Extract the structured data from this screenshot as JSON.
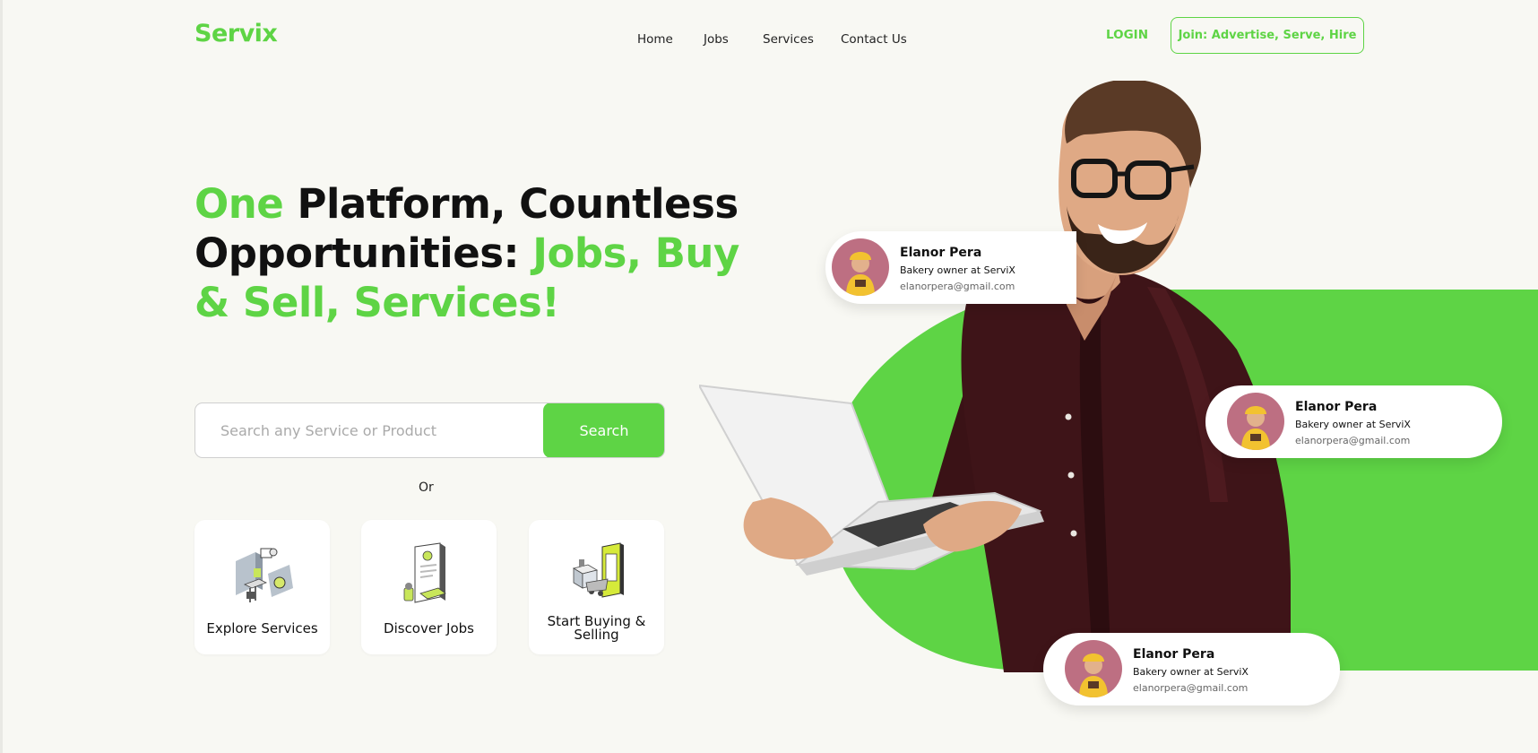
{
  "brand": {
    "logo": "Servix",
    "accent_color": "#5ed445"
  },
  "nav": {
    "items": [
      "Home",
      "Jobs",
      "Services",
      "Contact Us"
    ],
    "login_label": "LOGIN",
    "join_label": "Join: Advertise, Serve, Hire"
  },
  "hero": {
    "title_part1": "One",
    "title_part2": " Platform, Countless Opportunities: ",
    "title_part3": "Jobs, Buy & Sell, Services!"
  },
  "search": {
    "placeholder": "Search any Service or Product",
    "button_label": "Search",
    "or_label": "Or"
  },
  "cards": [
    {
      "label": "Explore Services",
      "icon": "services-illustration-icon"
    },
    {
      "label": "Discover Jobs",
      "icon": "jobs-illustration-icon"
    },
    {
      "label": "Start Buying & Selling",
      "icon": "buying-selling-illustration-icon"
    }
  ],
  "profiles": [
    {
      "name": "Elanor Pera",
      "role": "Bakery owner at ServiX",
      "email": "elanorpera@gmail.com"
    },
    {
      "name": "Elanor Pera",
      "role": "Bakery owner at ServiX",
      "email": "elanorpera@gmail.com"
    },
    {
      "name": "Elanor Pera",
      "role": "Bakery owner at ServiX",
      "email": "elanorpera@gmail.com"
    }
  ]
}
